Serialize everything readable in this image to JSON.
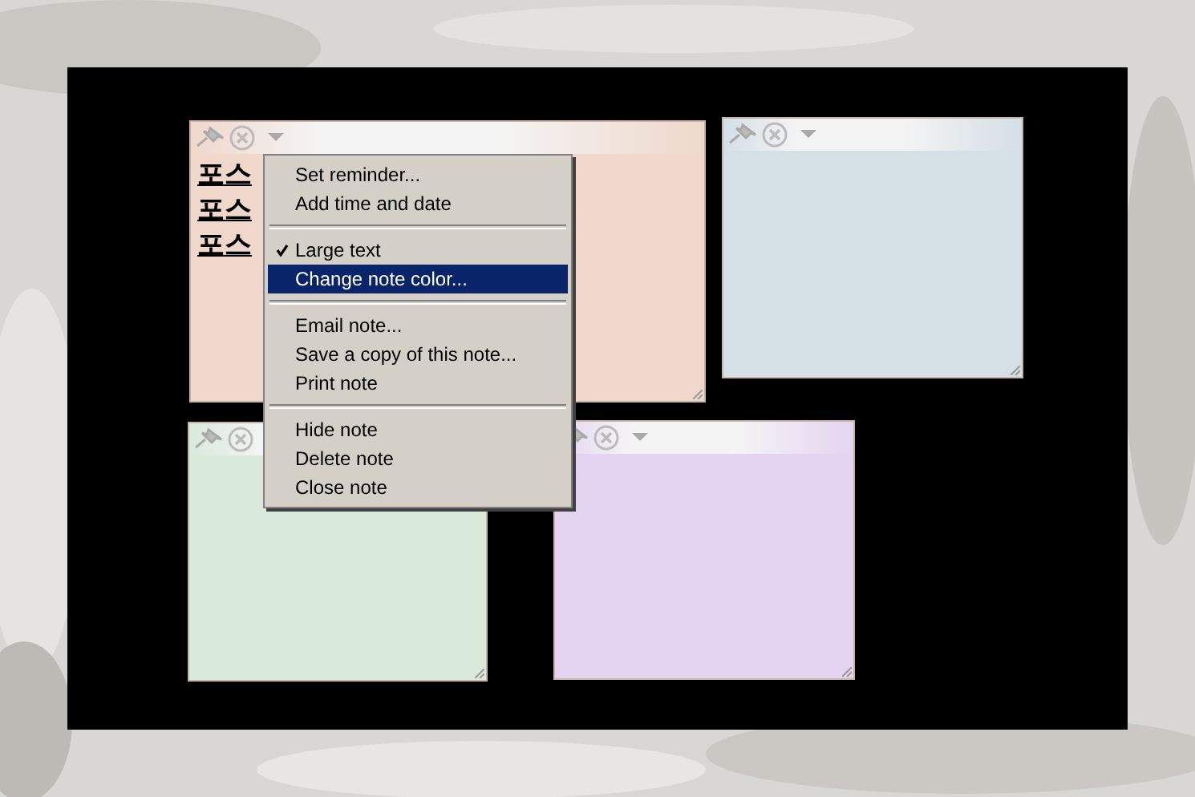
{
  "notes": [
    {
      "color": "#efd8cb",
      "lines": [
        "포스",
        "포스",
        "포스"
      ]
    },
    {
      "color": "#d4dfe6"
    },
    {
      "color": "#d9eadb"
    },
    {
      "color": "#e4d4f1"
    }
  ],
  "context_menu": {
    "items": [
      {
        "kind": "item",
        "label": "Set reminder...",
        "checked": false,
        "selected": false
      },
      {
        "kind": "item",
        "label": "Add time and date",
        "checked": false,
        "selected": false
      },
      {
        "kind": "separator"
      },
      {
        "kind": "item",
        "label": "Large text",
        "checked": true,
        "selected": false
      },
      {
        "kind": "item",
        "label": "Change note color...",
        "checked": false,
        "selected": true
      },
      {
        "kind": "separator"
      },
      {
        "kind": "item",
        "label": "Email note...",
        "checked": false,
        "selected": false
      },
      {
        "kind": "item",
        "label": "Save a copy of this note...",
        "checked": false,
        "selected": false
      },
      {
        "kind": "item",
        "label": "Print note",
        "checked": false,
        "selected": false
      },
      {
        "kind": "separator"
      },
      {
        "kind": "item",
        "label": "Hide note",
        "checked": false,
        "selected": false
      },
      {
        "kind": "item",
        "label": "Delete note",
        "checked": false,
        "selected": false
      },
      {
        "kind": "item",
        "label": "Close note",
        "checked": false,
        "selected": false
      }
    ]
  }
}
